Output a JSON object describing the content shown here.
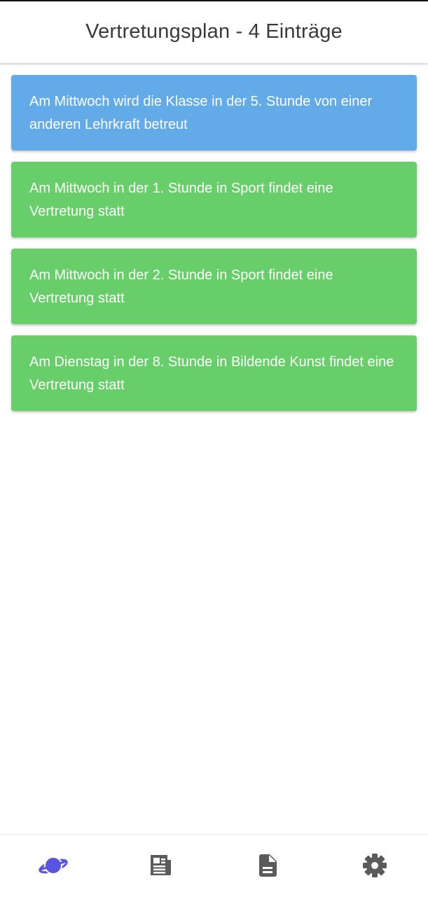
{
  "header": {
    "title": "Vertretungsplan - 4 Einträge"
  },
  "entries": [
    {
      "text": "Am Mittwoch wird die Klasse in der 5. Stunde von einer anderen Lehrkraft betreut",
      "color": "#62ABE8"
    },
    {
      "text": "Am Mittwoch in der 1. Stunde in Sport findet eine Vertretung statt",
      "color": "#67CE69"
    },
    {
      "text": "Am Mittwoch in der 2. Stunde in Sport findet eine Vertretung statt",
      "color": "#67CE69"
    },
    {
      "text": "Am Dienstag in der 8. Stunde in Bildende Kunst findet eine Vertretung statt",
      "color": "#67CE69"
    }
  ],
  "bottom_nav": {
    "items": [
      {
        "icon": "planet-icon",
        "active": true
      },
      {
        "icon": "newspaper-icon",
        "active": false
      },
      {
        "icon": "document-icon",
        "active": false
      },
      {
        "icon": "gear-icon",
        "active": false
      }
    ],
    "active_color": "#5A55E0",
    "inactive_color": "#5B5B5B"
  }
}
